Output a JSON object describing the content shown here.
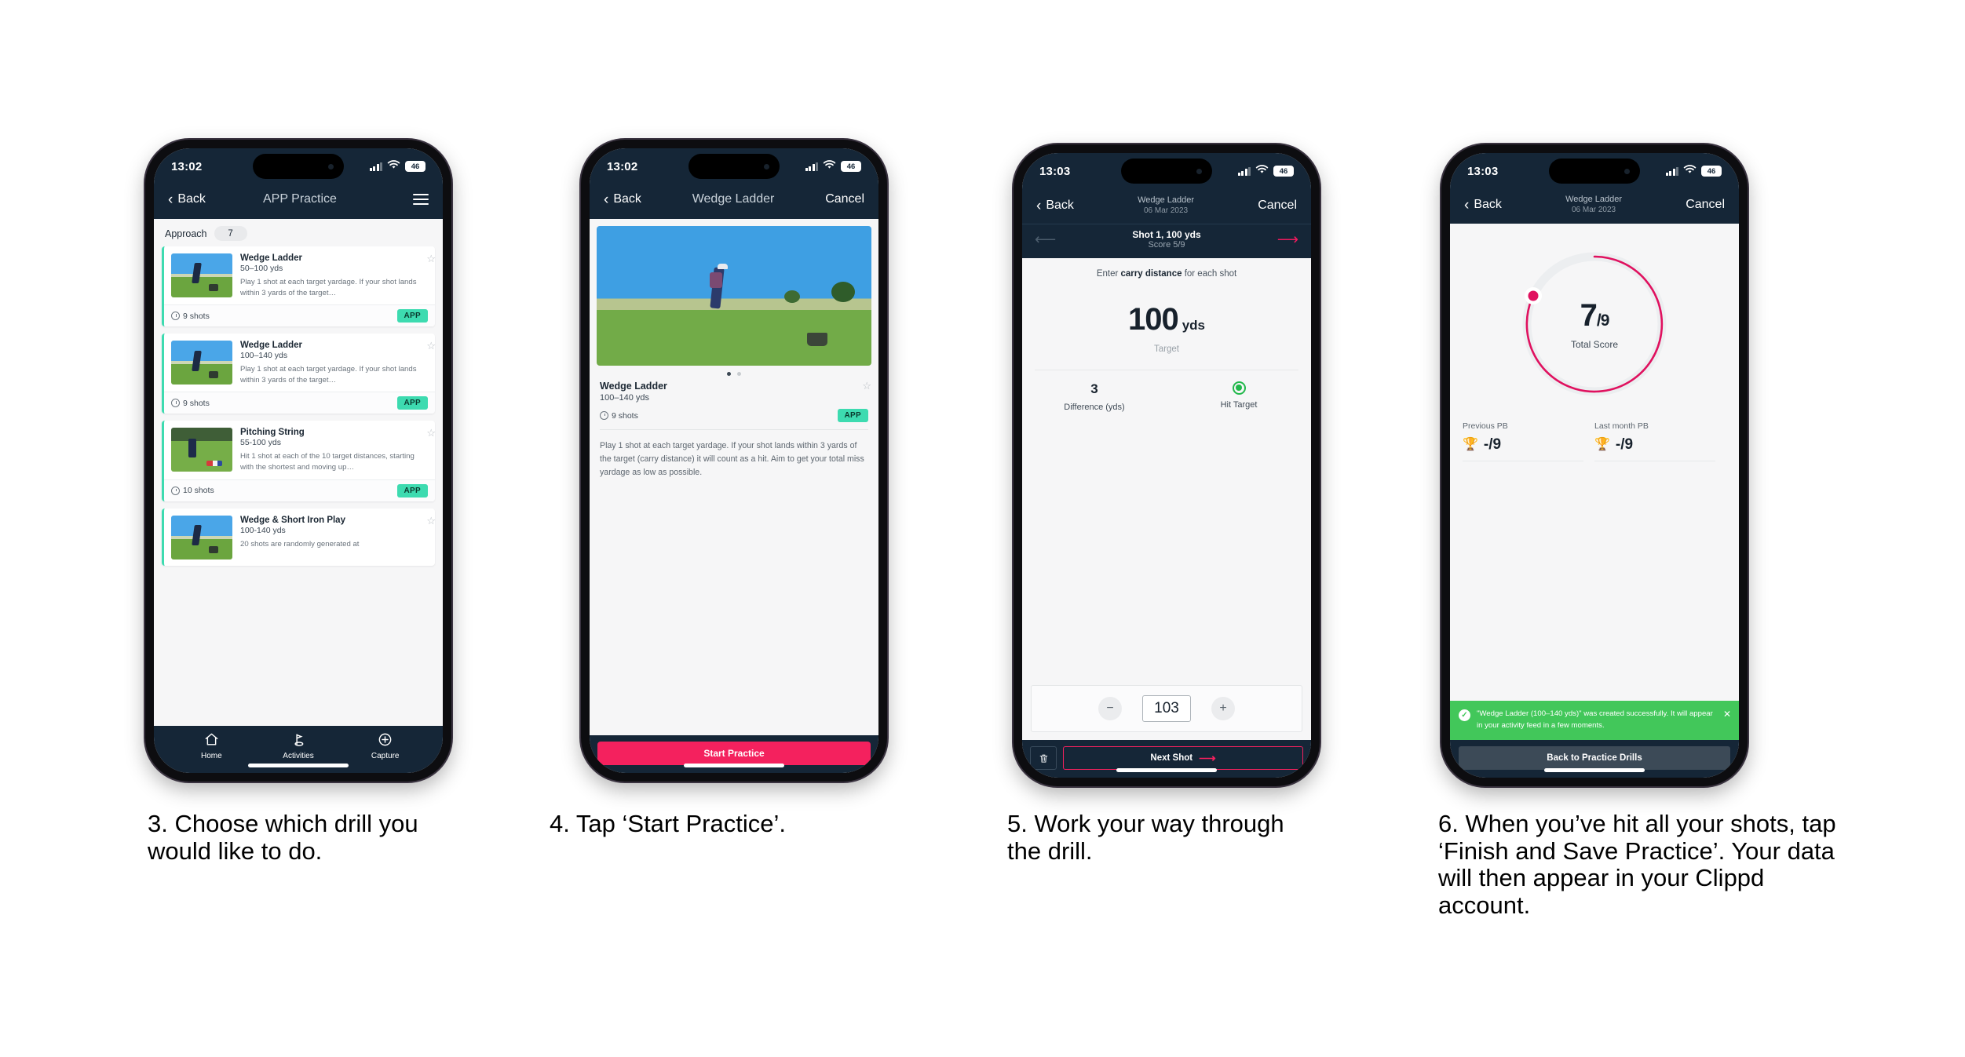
{
  "phones": [
    {
      "status": {
        "time": "13:02",
        "battery": "46"
      },
      "nav": {
        "back": "Back",
        "title": "APP Practice",
        "menu_icon": "hamburger-icon"
      },
      "section": {
        "label": "Approach",
        "count": "7"
      },
      "cards": [
        {
          "title": "Wedge Ladder",
          "range": "50–100 yds",
          "desc": "Play 1 shot at each target yardage. If your shot lands within 3 yards of the target…",
          "shots": "9 shots",
          "badge": "APP",
          "thumb": "range-photo"
        },
        {
          "title": "Wedge Ladder",
          "range": "100–140 yds",
          "desc": "Play 1 shot at each target yardage. If your shot lands within 3 yards of the target…",
          "shots": "9 shots",
          "badge": "APP",
          "thumb": "range-photo"
        },
        {
          "title": "Pitching String",
          "range": "55-100 yds",
          "desc": "Hit 1 shot at each of the 10 target distances, starting with the shortest and moving up…",
          "shots": "10 shots",
          "badge": "APP",
          "thumb": "fairway-photo"
        },
        {
          "title": "Wedge & Short Iron Play",
          "range": "100-140 yds",
          "desc": "20 shots are randomly generated at",
          "shots": "",
          "badge": "",
          "thumb": "range-photo"
        }
      ],
      "tabs": [
        {
          "label": "Home",
          "icon": "home-icon"
        },
        {
          "label": "Activities",
          "icon": "golf-flag-icon"
        },
        {
          "label": "Capture",
          "icon": "plus-circle-icon"
        }
      ]
    },
    {
      "status": {
        "time": "13:02",
        "battery": "46"
      },
      "nav": {
        "back": "Back",
        "title": "Wedge Ladder",
        "cancel": "Cancel"
      },
      "detail": {
        "title": "Wedge Ladder",
        "range": "100–140 yds",
        "shots": "9 shots",
        "badge": "APP",
        "description": "Play 1 shot at each target yardage. If your shot lands within 3 yards of the target (carry distance) it will count as a hit. Aim to get your total miss yardage as low as possible."
      },
      "cta": "Start Practice"
    },
    {
      "status": {
        "time": "13:03",
        "battery": "46"
      },
      "nav": {
        "back": "Back",
        "title": "Wedge Ladder",
        "subtitle": "06 Mar 2023",
        "cancel": "Cancel"
      },
      "shotbar": {
        "title": "Shot 1, 100 yds",
        "score": "Score 5/9"
      },
      "entry": {
        "hint_pre": "Enter ",
        "hint_bold": "carry distance",
        "hint_post": " for each shot",
        "target_value": "100",
        "target_unit": "yds",
        "target_label": "Target",
        "difference_value": "3",
        "difference_label": "Difference (yds)",
        "hit_label": "Hit Target",
        "stepper_value": "103",
        "minus": "−",
        "plus": "+"
      },
      "footer": {
        "delete_icon": "trash-icon",
        "next": "Next Shot",
        "next_arrow": "⟶"
      }
    },
    {
      "status": {
        "time": "13:03",
        "battery": "46"
      },
      "nav": {
        "back": "Back",
        "title": "Wedge Ladder",
        "subtitle": "06 Mar 2023",
        "cancel": "Cancel"
      },
      "summary": {
        "score_num": "7",
        "score_den": "/9",
        "score_label": "Total Score",
        "previous_pb_label": "Previous PB",
        "previous_pb_value": "-/9",
        "last_month_pb_label": "Last month PB",
        "last_month_pb_value": "-/9",
        "trophy_icon": "trophy-icon"
      },
      "toast": {
        "message": "\"Wedge Ladder (100–140 yds)\" was created successfully. It will appear in your activity feed in a few moments.",
        "close": "✕",
        "check": "✓"
      },
      "footer_button": "Back to Practice Drills"
    }
  ],
  "captions": [
    "3. Choose which drill you would like to do.",
    "4. Tap ‘Start Practice’.",
    "5. Work your way through the drill.",
    "6. When you’ve hit all your shots, tap ‘Finish and Save Practice’. Your data will then appear in your Clippd account."
  ],
  "colors": {
    "nav_dark": "#152637",
    "accent_pink": "#f4215e",
    "accent_teal": "#3ddbb0",
    "toast_green": "#42c75a",
    "ring_pink": "#e0115f"
  }
}
